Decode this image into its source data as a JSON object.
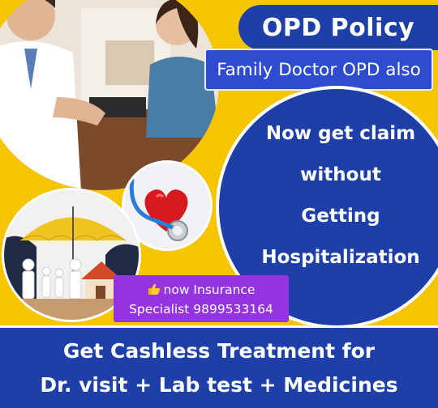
{
  "header": {
    "policy_title": "OPD Policy",
    "family_line": "Family Doctor OPD also"
  },
  "claim": {
    "lines": [
      "Now get claim",
      "without",
      "Getting",
      "Hospitalization"
    ]
  },
  "specialist": {
    "thumb_icon": "thumbs-up-icon",
    "line1": "now  Insurance",
    "line2": "Specialist 9899533164"
  },
  "footer": {
    "line1": "Get Cashless Treatment for",
    "line2": "Dr. visit + Lab test + Medicines"
  },
  "colors": {
    "background": "#f7c400",
    "blue": "#1e3fa8",
    "purple": "#9433e0"
  }
}
